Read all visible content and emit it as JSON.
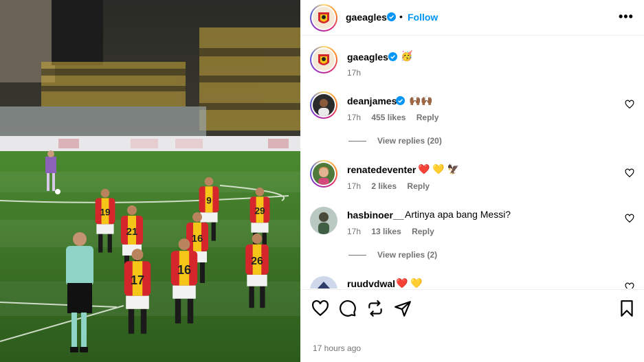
{
  "post": {
    "username": "gaeagles",
    "follow_label": "Follow",
    "more_label": "•••",
    "dot": "•"
  },
  "caption": {
    "username": "gaeagles",
    "emoji": "🥳",
    "time": "17h"
  },
  "comments": [
    {
      "username": "deanjames",
      "verified": true,
      "text": "🙌🏾🙌🏾",
      "time": "17h",
      "likes": "455 likes",
      "reply": "Reply",
      "view_replies": "View replies (20)"
    },
    {
      "username": "renatedeventer",
      "verified": false,
      "text": "❤️ 💛 🦅",
      "time": "17h",
      "likes": "2 likes",
      "reply": "Reply"
    },
    {
      "username": "hasbinoer__",
      "verified": false,
      "text": "Artinya apa bang Messi?",
      "time": "17h",
      "likes": "13 likes",
      "reply": "Reply",
      "view_replies": "View replies (2)"
    },
    {
      "username": "ruudvdwal",
      "verified": false,
      "text": "❤️ 💛"
    }
  ],
  "actions": [
    "heart-icon",
    "comment-icon",
    "repost-icon",
    "share-icon",
    "save-icon"
  ],
  "footer": {
    "timestamp": "17 hours ago"
  },
  "photo": {
    "jersey_numbers": [
      "19",
      "21",
      "9",
      "29",
      "16",
      "26",
      "17",
      "16"
    ],
    "colors": {
      "red": "#d5262b",
      "yellow": "#f5c518",
      "pitch": "#3f7a2a",
      "referee": "#8fd3c7"
    }
  },
  "colors": {
    "accent": "#0095f6",
    "muted": "#737373",
    "verified": "#0095f6"
  }
}
